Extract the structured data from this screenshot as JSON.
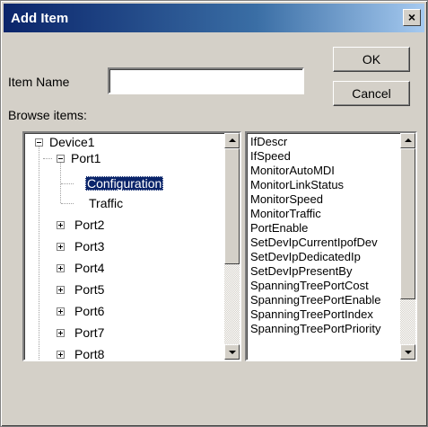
{
  "window": {
    "title": "Add Item",
    "close_glyph": "×"
  },
  "form": {
    "item_name_label": "Item Name",
    "item_name_value": "",
    "browse_label": "Browse items:"
  },
  "buttons": {
    "ok": "OK",
    "cancel": "Cancel"
  },
  "tree": {
    "root": "Device1",
    "port1": "Port1",
    "config": "Configuration",
    "traffic": "Traffic",
    "ports": [
      "Port2",
      "Port3",
      "Port4",
      "Port5",
      "Port6",
      "Port7",
      "Port8"
    ]
  },
  "items": [
    "IfDescr",
    "IfSpeed",
    "MonitorAutoMDI",
    "MonitorLinkStatus",
    "MonitorSpeed",
    "MonitorTraffic",
    "PortEnable",
    "SetDevIpCurrentIpofDev",
    "SetDevIpDedicatedIp",
    "SetDevIpPresentBy",
    "SpanningTreePortCost",
    "SpanningTreePortEnable",
    "SpanningTreePortIndex",
    "SpanningTreePortPriority"
  ],
  "colors": {
    "dialog_bg": "#d4d0c8",
    "titlebar": "#0a246a",
    "selection": "#0a246a"
  },
  "icons": {
    "close": "close-icon",
    "scroll_up": "arrow-up-icon",
    "scroll_down": "arrow-down-icon",
    "expand": "plus-icon",
    "collapse": "minus-icon"
  }
}
